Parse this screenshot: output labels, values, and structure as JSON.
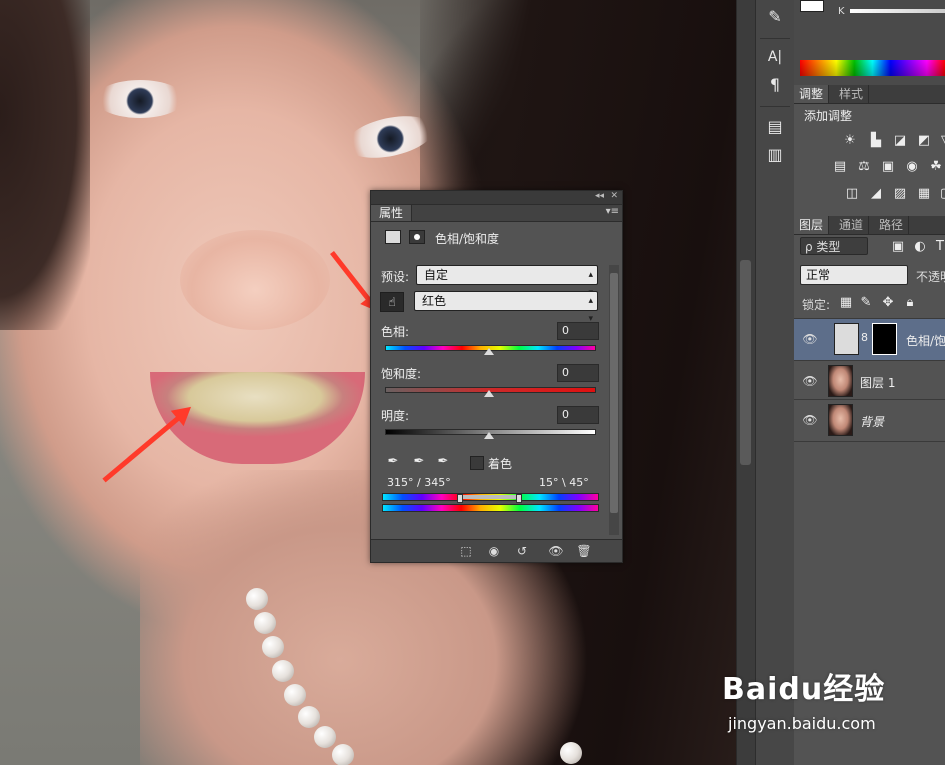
{
  "rightpanel": {
    "color_k_label": "K",
    "adjust_tabs": [
      "调整",
      "样式"
    ],
    "adjust_title": "添加调整",
    "adjust_icons_row1": [
      "☀",
      "▙",
      "◪",
      "◩",
      "▽"
    ],
    "adjust_icons_row2": [
      "▤",
      "⚖",
      "▣",
      "◉",
      "☘"
    ],
    "adjust_icons_row3": [
      "◫",
      "◢",
      "▨",
      "▦",
      "▢"
    ],
    "layers_tabs": [
      "图层",
      "通道",
      "路径"
    ],
    "filter_label": "ρ 类型",
    "blend_mode": "正常",
    "opacity_label": "不透明",
    "lock_label": "锁定:",
    "layers": [
      {
        "name": "色相/饱",
        "selected": true
      },
      {
        "name": "图层 1",
        "selected": false
      },
      {
        "name": "背景",
        "selected": false
      }
    ]
  },
  "properties": {
    "tab": "属性",
    "title": "色相/饱和度",
    "preset_label": "预设:",
    "preset_value": "自定",
    "channel_value": "红色",
    "hue_label": "色相:",
    "hue_value": "0",
    "saturation_label": "饱和度:",
    "saturation_value": "0",
    "lightness_label": "明度:",
    "lightness_value": "0",
    "colorize_label": "着色",
    "colorize_checked": false,
    "range_left": "315° / 345°",
    "range_right": "15° \\ 45°"
  },
  "watermark": {
    "brand": "Baidu经验",
    "url": "jingyan.baidu.com"
  }
}
